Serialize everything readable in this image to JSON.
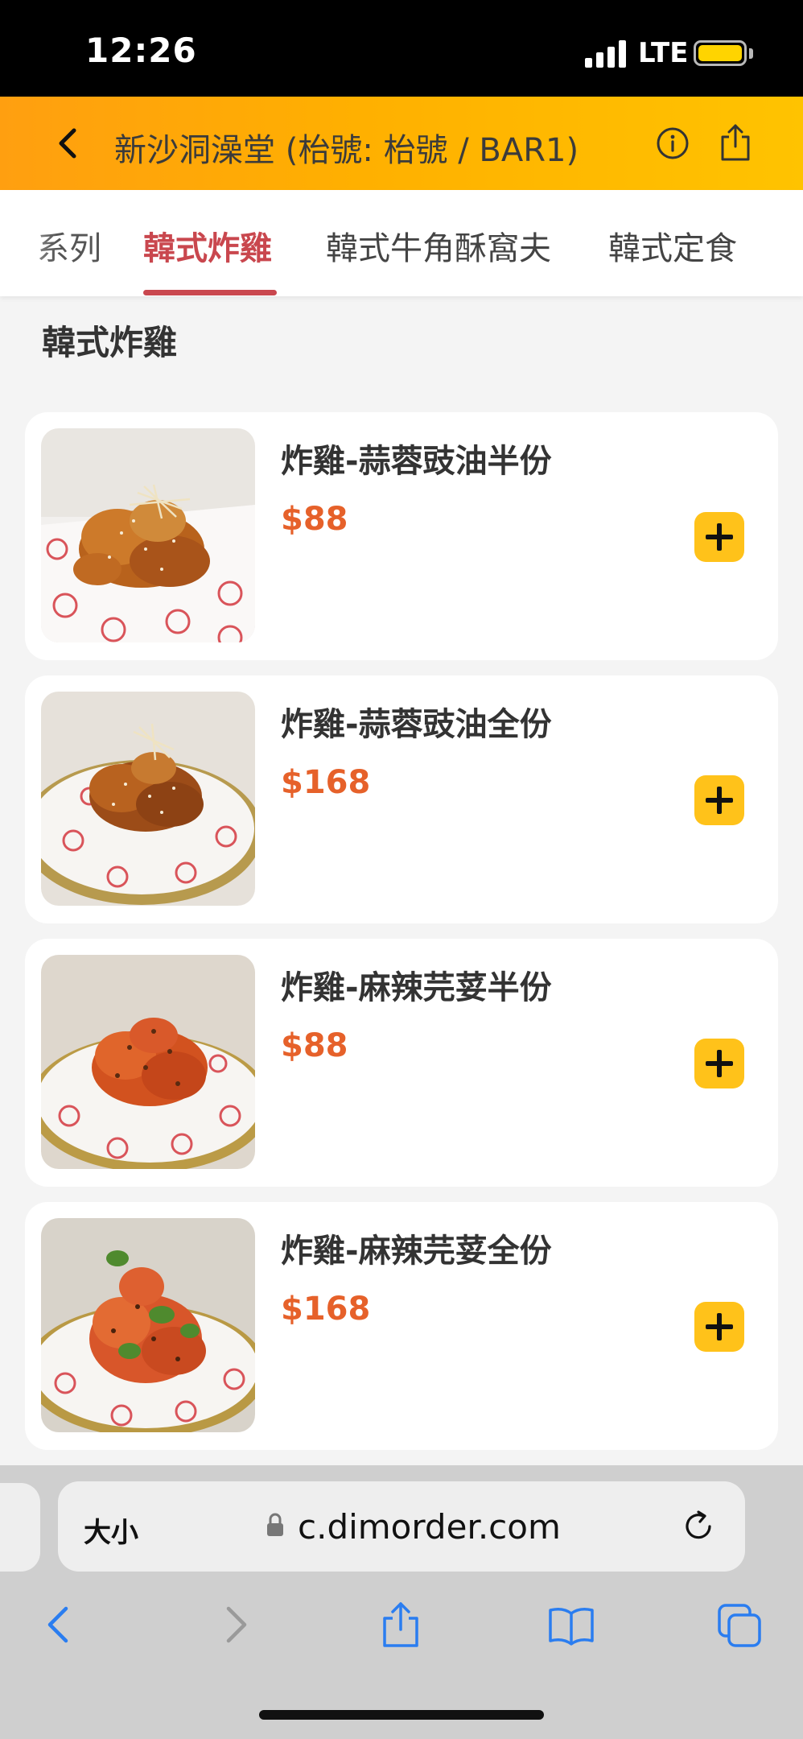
{
  "status_bar": {
    "time": "12:26",
    "network": "LTE"
  },
  "header": {
    "title": "新沙洞澡堂 (枱號: 枱號 / BAR1)",
    "icons": [
      "back-icon",
      "info-icon",
      "share-icon"
    ]
  },
  "tabs": [
    {
      "label": "系列",
      "active": false
    },
    {
      "label": "韓式炸雞",
      "active": true
    },
    {
      "label": "韓式牛角酥窩夫",
      "active": false
    },
    {
      "label": "韓式定食",
      "active": false
    }
  ],
  "section": {
    "title": "韓式炸雞"
  },
  "items": [
    {
      "name": "炸雞-蒜蓉豉油半份",
      "price": "$88"
    },
    {
      "name": "炸雞-蒜蓉豉油全份",
      "price": "$168"
    },
    {
      "name": "炸雞-麻辣芫荽半份",
      "price": "$88"
    },
    {
      "name": "炸雞-麻辣芫荽全份",
      "price": "$168"
    }
  ],
  "browser": {
    "text_size_label": "大小",
    "url": "c.dimorder.com",
    "toolbar": [
      "back-icon",
      "forward-icon",
      "share-icon",
      "bookmarks-icon",
      "tabs-icon"
    ]
  },
  "colors": {
    "accent": "#c9474e",
    "price": "#e6612a",
    "add_button": "#ffc21a",
    "header_start": "#ff9f10",
    "header_end": "#ffc300"
  }
}
